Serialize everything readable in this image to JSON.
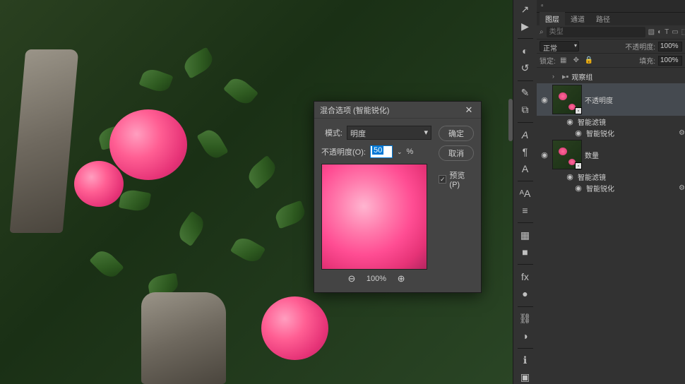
{
  "panel": {
    "tabs": [
      "图层",
      "通道",
      "路径"
    ],
    "search_placeholder": "类型",
    "blend_mode": "正常",
    "opacity_label": "不透明度:",
    "opacity_value": "100%",
    "lock_label": "锁定:",
    "fill_label": "填充:",
    "fill_value": "100%"
  },
  "layers": {
    "group_name": "观察组",
    "layer1": {
      "name": "不透明度",
      "smart_filters_label": "智能滤镜",
      "filter_name": "智能锐化"
    },
    "layer2": {
      "name": "数量",
      "smart_filters_label": "智能滤镜",
      "filter_name": "智能锐化"
    }
  },
  "dialog": {
    "title": "混合选项 (智能锐化)",
    "mode_label": "模式:",
    "mode_value": "明度",
    "opacity_label": "不透明度(O):",
    "opacity_value": "50",
    "opacity_suffix": "%",
    "ok": "确定",
    "cancel": "取消",
    "preview_label": "预览(P)",
    "zoom_value": "100%"
  },
  "icons": {
    "search": "⌕",
    "filter": "⎃",
    "image": "▧",
    "adjust": "◐",
    "text": "T",
    "shape": "▭",
    "smart": "⬚",
    "share": "↗",
    "play": "▶",
    "history": "↺",
    "brush": "✎",
    "clone": "⧉",
    "align": "≡",
    "char_a": "A",
    "para": "¶",
    "glyph": "fi",
    "char2": "ᴬA",
    "ruler": "⊞",
    "grid": "▦",
    "swatch": "■",
    "fx": "fx",
    "fx2": "●",
    "link": "⛓",
    "color": "◑",
    "info": "ℹ",
    "layers": "❐",
    "nav": "▣",
    "close": "✕",
    "check": "✓",
    "zoom_out": "⊖",
    "zoom_in": "⊕",
    "eye": "👁",
    "chevron": "›",
    "chevdown": "⌄",
    "folder": "📁",
    "doc": "▫"
  }
}
